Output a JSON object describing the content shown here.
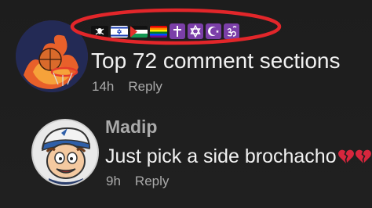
{
  "comments": [
    {
      "author": "",
      "badges": [
        "skull-flag-icon",
        "israel-flag-icon",
        "palestine-flag-icon",
        "rainbow-flag-icon",
        "cross-icon",
        "star-of-david-icon",
        "star-and-crescent-icon",
        "om-icon"
      ],
      "text": "Top 72 comment sections",
      "time": "14h",
      "reply_label": "Reply"
    },
    {
      "author": "Madip",
      "text": "Just pick a side brochacho",
      "text_emoji": "broken-heart-icon",
      "time": "9h",
      "reply_label": "Reply"
    }
  ],
  "highlight_color": "#e2262a",
  "badge_color": "#7b3fa8"
}
